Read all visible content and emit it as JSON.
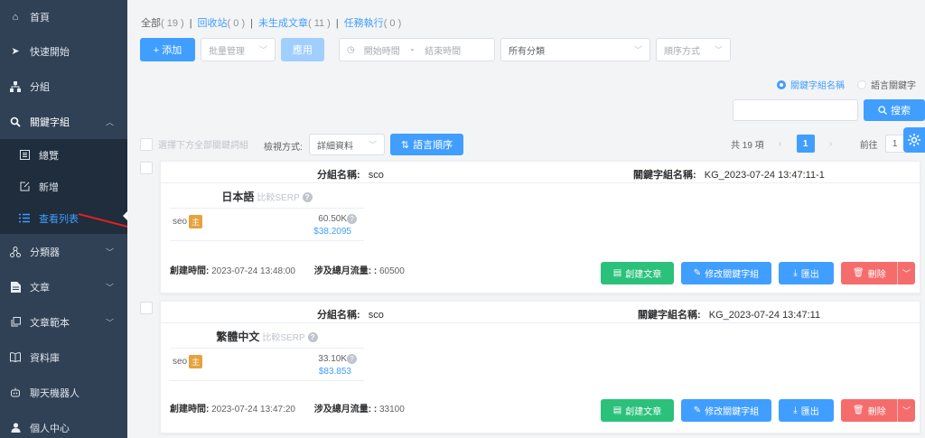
{
  "sidebar": {
    "items": [
      {
        "label": "首頁",
        "icon": "home-icon"
      },
      {
        "label": "快速開始",
        "icon": "send-icon"
      },
      {
        "label": "分組",
        "icon": "sitemap-icon"
      },
      {
        "label": "關鍵字組",
        "icon": "search-icon"
      },
      {
        "label": "總覽",
        "icon": "list-icon"
      },
      {
        "label": "新增",
        "icon": "edit-icon"
      },
      {
        "label": "查看列表",
        "icon": "list-bullets-icon"
      },
      {
        "label": "分類器",
        "icon": "share-icon"
      },
      {
        "label": "文章",
        "icon": "document-icon"
      },
      {
        "label": "文章範本",
        "icon": "copy-icon"
      },
      {
        "label": "資料庫",
        "icon": "book-icon"
      },
      {
        "label": "聊天機器人",
        "icon": "robot-icon"
      },
      {
        "label": "個人中心",
        "icon": "user-icon"
      }
    ],
    "accent": "#409eff"
  },
  "filters": {
    "all_label": "全部",
    "all_count": "( 19 )",
    "recycle_label": "回收站",
    "recycle_count": "( 0 )",
    "ungen_label": "未生成文章",
    "ungen_count": "( 11 )",
    "task_label": "任務執行",
    "task_count": "( 0 )"
  },
  "toolbar": {
    "add_label": "+ 添加",
    "bulk_placeholder": "批量管理",
    "apply_label": "應用",
    "start_time_placeholder": "開始時間",
    "range_sep": "-",
    "end_time_placeholder": "結束時間",
    "category_value": "所有分類",
    "sort_placeholder": "順序方式"
  },
  "search_mode": {
    "option1": "關鍵字組名稱",
    "option2": "語言關鍵字"
  },
  "search": {
    "button_label": "搜索"
  },
  "list": {
    "select_all_label": "選擇下方全部關鍵詞組",
    "view_label": "檢視方式:",
    "view_value": "詳細資料",
    "sort_button": "語言順序",
    "total_text": "共 19 項",
    "current_page": "1",
    "goto_label": "前往",
    "goto_value": "1"
  },
  "cards": [
    {
      "group_label": "分組名稱:",
      "group_value": "sco",
      "kg_label": "關鍵字組名稱:",
      "kg_value": "KG_2023-07-24 13:47:11-1",
      "lang": "日本語",
      "compare": "比較SERP",
      "kw": "seo",
      "badge": "主",
      "volume": "60.50K",
      "cpc": "$38.2095",
      "created_label": "創建時間:",
      "created_value": "2023-07-24 13:48:00",
      "traffic_label": "涉及總月流量: :",
      "traffic_value": "60500"
    },
    {
      "group_label": "分組名稱:",
      "group_value": "sco",
      "kg_label": "關鍵字組名稱:",
      "kg_value": "KG_2023-07-24 13:47:11",
      "lang": "繁體中文",
      "compare": "比較SERP",
      "kw": "seo",
      "badge": "主",
      "volume": "33.10K",
      "cpc": "$83.853",
      "created_label": "創建時間:",
      "created_value": "2023-07-24 13:47:20",
      "traffic_label": "涉及總月流量: :",
      "traffic_value": "33100"
    }
  ],
  "actions": {
    "create_article": "創建文章",
    "edit_group": "修改關鍵字組",
    "export": "匯出",
    "delete": "刪除"
  }
}
